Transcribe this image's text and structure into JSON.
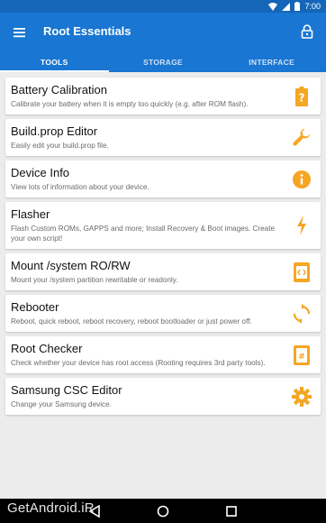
{
  "status_bar": {
    "time": "7:00"
  },
  "app_bar": {
    "title": "Root Essentials"
  },
  "tabs": [
    {
      "label": "TOOLS"
    },
    {
      "label": "STORAGE"
    },
    {
      "label": "INTERFACE"
    }
  ],
  "items": [
    {
      "title": "Battery Calibration",
      "desc": "Calibrate your battery when it is empty too quickly (e.g. after ROM flash).",
      "icon": "battery-alert-icon"
    },
    {
      "title": "Build.prop Editor",
      "desc": "Easily edit your build.prop file.",
      "icon": "wrench-icon"
    },
    {
      "title": "Device Info",
      "desc": "View lots of information about your device.",
      "icon": "info-icon"
    },
    {
      "title": "Flasher",
      "desc": "Flash Custom ROMs, GAPPS and more; Install Recovery & Boot images. Create your own script!",
      "icon": "flash-icon"
    },
    {
      "title": "Mount /system RO/RW",
      "desc": "Mount your /system partition rewritable or readonly.",
      "icon": "mount-icon"
    },
    {
      "title": "Rebooter",
      "desc": "Reboot, quick reboot, reboot recovery, reboot bootloader or just power off.",
      "icon": "reboot-icon"
    },
    {
      "title": "Root Checker",
      "desc": "Check whether your device has root access (Rooting requires 3rd party tools).",
      "icon": "root-check-icon"
    },
    {
      "title": "Samsung CSC Editor",
      "desc": "Change your Samsung device.",
      "icon": "gear-icon"
    }
  ],
  "watermark": "GetAndroid.iR",
  "colors": {
    "primary": "#1976d2",
    "accent": "#f5a623"
  }
}
